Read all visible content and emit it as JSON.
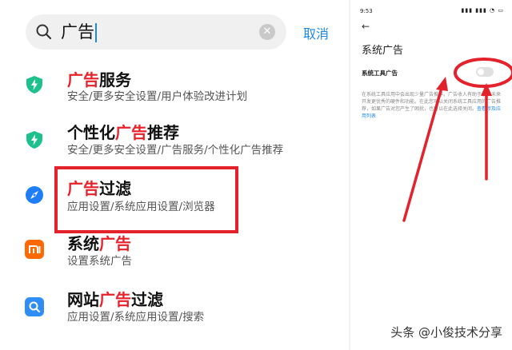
{
  "search": {
    "query": "广告",
    "cancel_label": "取消"
  },
  "results": [
    {
      "title_pre": "",
      "title_hl": "广告",
      "title_post": "服务",
      "subtitle": "安全/更多安全设置/用户体验改进计划",
      "icon": "shield-icon",
      "icon_color": "#1ec18c"
    },
    {
      "title_pre": "个性化",
      "title_hl": "广告",
      "title_post": "推荐",
      "subtitle": "安全/更多安全设置/广告服务/个性化广告推荐",
      "icon": "shield-icon",
      "icon_color": "#1ec18c"
    },
    {
      "title_pre": "",
      "title_hl": "广告",
      "title_post": "过滤",
      "subtitle": "应用设置/系统应用设置/浏览器",
      "icon": "browser-icon",
      "icon_color": "#1e7ef7"
    },
    {
      "title_pre": "系统",
      "title_hl": "广告",
      "title_post": "",
      "subtitle": "设置系统广告",
      "icon": "mi-logo-icon",
      "icon_color": "#ff6900"
    },
    {
      "title_pre": "网站",
      "title_hl": "广告",
      "title_post": "过滤",
      "subtitle": "应用设置/系统应用设置/搜索",
      "icon": "search-app-icon",
      "icon_color": "#2f8df5"
    }
  ],
  "settings_page": {
    "time": "9:53",
    "title": "系统广告",
    "setting_label": "系统工具广告",
    "toggle_on": false,
    "description": "在系统工具应用中会出现少量广告推荐。广告收入有助于小米未来开发更优秀的硬件和功能。在此您可以关闭系统工具应用的广告推荐，如果广告对您产生了困扰，也可以在此选择关闭。",
    "link": "查看涉及应用列表"
  },
  "watermark": "头条 @小俊技术分享",
  "colors": {
    "highlight": "#e6212a",
    "accent": "#1e88e5",
    "annotation": "#e3222b"
  }
}
